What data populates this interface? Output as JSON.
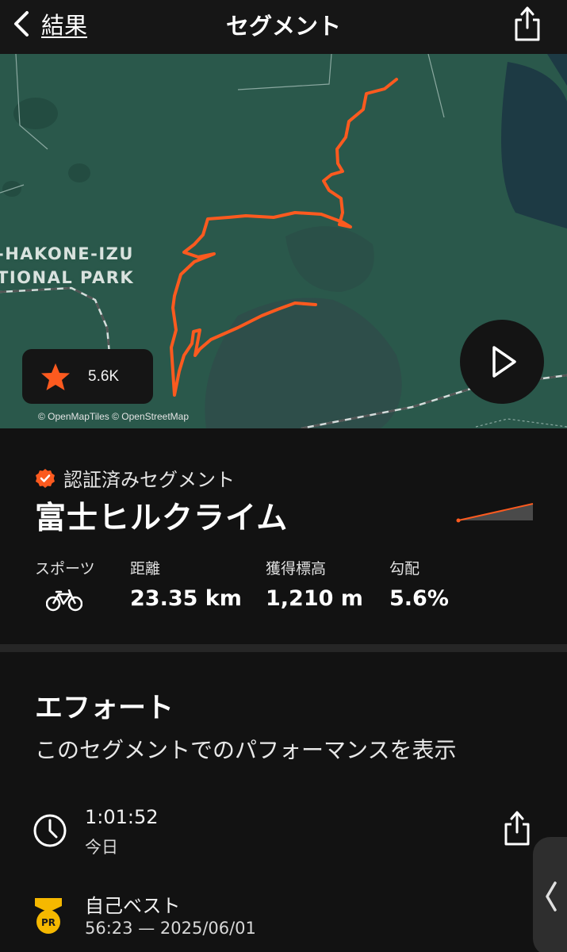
{
  "header": {
    "back_label": "結果",
    "title": "セグメント"
  },
  "map": {
    "park_label_line1": "-HAKONE-IZU",
    "park_label_line2": "TIONAL PARK",
    "star_count": "5.6K",
    "attribution": "© OpenMapTiles © OpenStreetMap",
    "route_color": "#fc5a1f"
  },
  "segment": {
    "verified_label": "認証済みセグメント",
    "name": "富士ヒルクライム",
    "stats": [
      {
        "label": "スポーツ",
        "icon": "bike-icon"
      },
      {
        "label": "距離",
        "value": "23.35 km"
      },
      {
        "label": "獲得標高",
        "value": "1,210 m"
      },
      {
        "label": "勾配",
        "value": "5.6%"
      }
    ]
  },
  "effort": {
    "title": "エフォート",
    "subtitle": "このセグメントでのパフォーマンスを表示",
    "rows": [
      {
        "icon": "clock-icon",
        "primary": "1:01:52",
        "secondary": "今日"
      },
      {
        "icon": "pr-medal-icon",
        "primary": "自己ベスト",
        "secondary": "56:23 — 2025/06/01"
      }
    ]
  },
  "colors": {
    "accent": "#fc5a1f",
    "background": "#121212",
    "map_green": "#2a584b",
    "medal_gold": "#f5b800"
  }
}
